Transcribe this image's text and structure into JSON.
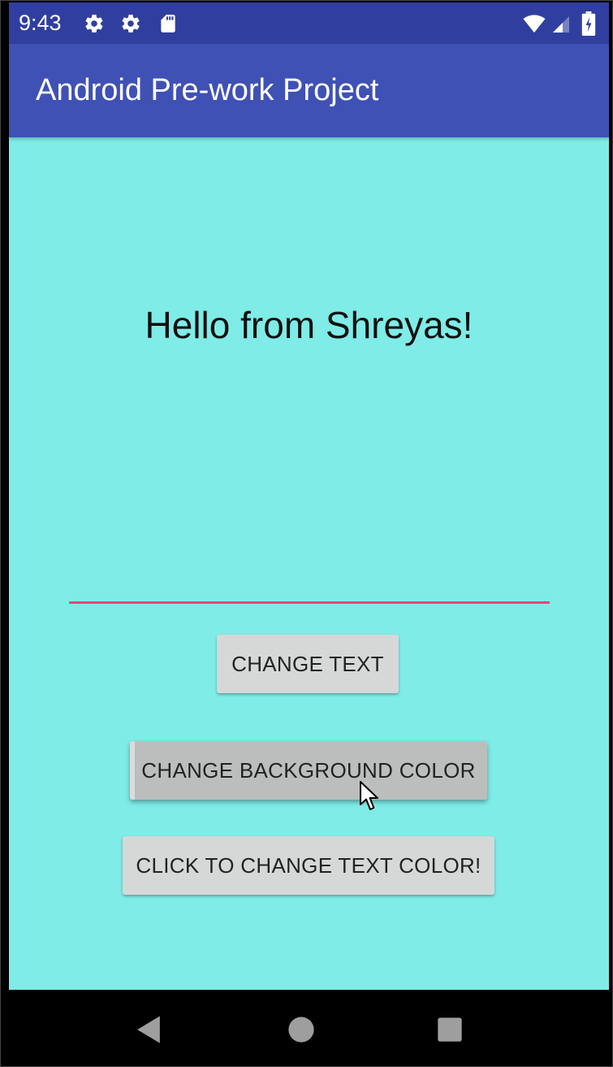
{
  "status_bar": {
    "time": "9:43",
    "left_icons": [
      "gear-icon",
      "gear-icon",
      "sd-card-icon"
    ],
    "right_icons": [
      "wifi-icon",
      "cell-signal-icon",
      "battery-icon"
    ]
  },
  "app_bar": {
    "title": "Android Pre-work Project",
    "color": "#3f51b5",
    "status_color": "#303f9f"
  },
  "main": {
    "background_color": "#7fece7",
    "hello_text": "Hello from Shreyas!",
    "edit_text": {
      "value": "",
      "placeholder": "",
      "underline_color": "#f0417c"
    },
    "buttons": {
      "change_text": "CHANGE TEXT",
      "change_background": "CHANGE BACKGROUND COLOR",
      "change_text_color": "CLICK TO CHANGE TEXT COLOR!"
    }
  },
  "nav_bar": {
    "icons": [
      "back-icon",
      "home-icon",
      "recents-icon"
    ]
  }
}
